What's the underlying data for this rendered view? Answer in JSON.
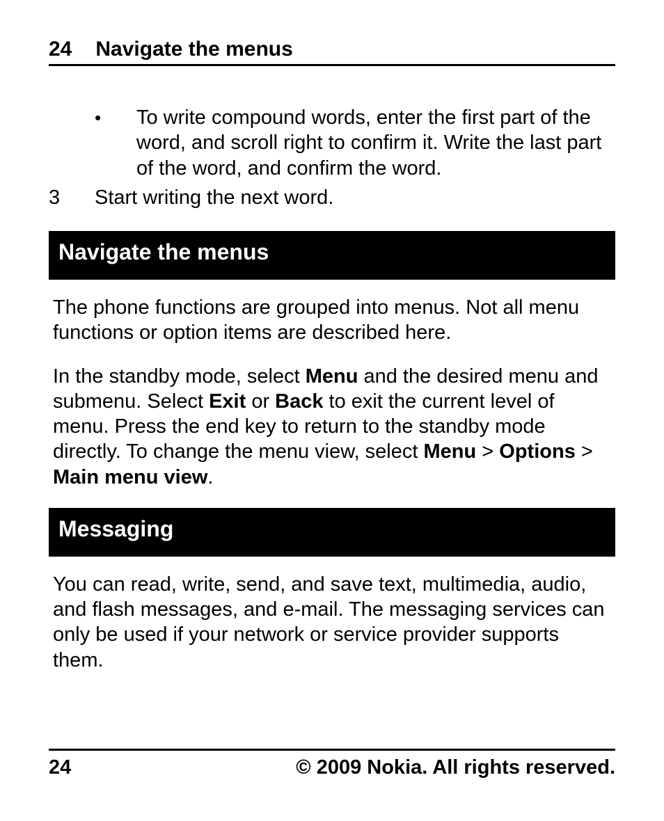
{
  "header": {
    "page_number": "24",
    "title": "Navigate the menus"
  },
  "bullet": {
    "text": "To write compound words, enter the first part of the word, and scroll right to confirm it. Write the last part of the word, and confirm the word."
  },
  "step3": {
    "num": "3",
    "text": "Start writing the next word."
  },
  "sec_navigate": {
    "heading": "Navigate the menus",
    "p1": "The phone functions are grouped into menus. Not all menu functions or option items are described here.",
    "p2a": "In the standby mode, select ",
    "p2_menu1": "Menu",
    "p2b": " and the desired menu and submenu. Select ",
    "p2_exit": "Exit",
    "p2c": " or ",
    "p2_back": "Back",
    "p2d": " to exit the current level of menu. Press the end key to return to the standby mode directly. To change the menu view, select ",
    "p2_menu2": "Menu",
    "p2e": " > ",
    "p2_options": "Options",
    "p2f": " > ",
    "p2_mainview": "Main menu view",
    "p2g": "."
  },
  "sec_messaging": {
    "heading": "Messaging",
    "p1": "You can read, write, send, and save text, multimedia, audio, and flash messages, and e-mail. The messaging services can only be used if your network or service provider supports them."
  },
  "footer": {
    "page_number": "24",
    "copyright": "© 2009 Nokia. All rights reserved."
  }
}
